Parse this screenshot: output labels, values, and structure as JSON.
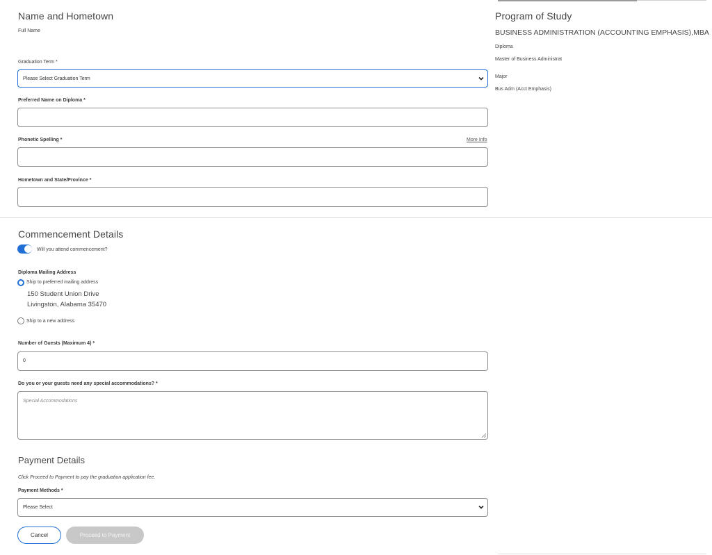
{
  "name_hometown": {
    "title": "Name and Hometown",
    "full_name_label": "Full Name",
    "graduation_term_label": "Graduation Term *",
    "graduation_term_value": "Please Select Graduation Term",
    "preferred_name_label": "Preferred Name on Diploma *",
    "preferred_name_value": "",
    "phonetic_label": "Phonetic Spelling *",
    "more_info_link": "More Info",
    "phonetic_value": "",
    "hometown_label": "Hometown and State/Province *",
    "hometown_value": ""
  },
  "program": {
    "title": "Program of Study",
    "program_name": "BUSINESS ADMINISTRATION (ACCOUNTING EMPHASIS),MBA",
    "diploma_label": "Diploma",
    "diploma_value": "Master of Business Administrat",
    "major_label": "Major",
    "major_value": "Bus Adm (Acct Emphasis)"
  },
  "commencement": {
    "title": "Commencement Details",
    "attend_toggle_label": "Will you attend commencement?",
    "attend_toggle_on": true,
    "mailing_label": "Diploma Mailing Address",
    "option_preferred": "Ship to preferred mailing address",
    "address_line1": "150 Student Union Drive",
    "address_line2": "Livingston, Alabama 35470",
    "option_new": "Ship to a new address",
    "guests_label": "Number of Guests (Maximum 4) *",
    "guests_value": "0",
    "accommodations_label": "Do you or your guests need any special accommodations? *",
    "accommodations_placeholder": "Special Accommodations"
  },
  "payment": {
    "title": "Payment Details",
    "note": "Click Proceed to Payment to pay the graduation application fee.",
    "methods_label": "Payment Methods *",
    "methods_value": "Please Select"
  },
  "actions": {
    "cancel_label": "Cancel",
    "proceed_label": "Proceed to Payment"
  },
  "colors": {
    "accent": "#1f6fd6",
    "disabled_button": "#c8c8c8"
  }
}
